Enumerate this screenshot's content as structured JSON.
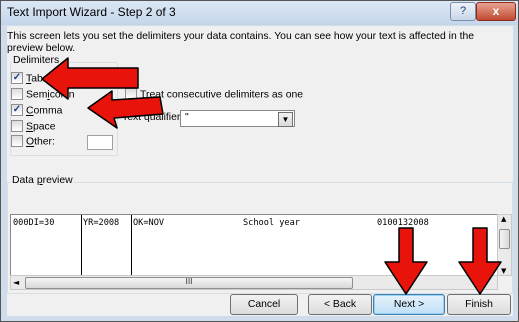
{
  "window": {
    "title": "Text Import Wizard - Step 2 of 3",
    "help_label": "?",
    "close_label": "x"
  },
  "description": "This screen lets you set the delimiters your data contains.  You can see how your text is affected in the preview below.",
  "delimiters": {
    "group_label": "Delimiters",
    "items": [
      {
        "label": "Tab",
        "checked": true
      },
      {
        "label": "Semicolon",
        "checked": false
      },
      {
        "label": "Comma",
        "checked": true
      },
      {
        "label": "Space",
        "checked": false
      },
      {
        "label": "Other:",
        "checked": false
      }
    ],
    "other_value": ""
  },
  "consecutive": {
    "label": "Treat consecutive delimiters as one",
    "checked": false
  },
  "text_qualifier": {
    "label": "Text qualifier:",
    "value": "\""
  },
  "preview": {
    "group_label": "Data preview",
    "columns": [
      "000DI=30",
      "YR=2008",
      "OK=NOV",
      "School year",
      "0100132008"
    ],
    "thumb_glyph": "III"
  },
  "buttons": {
    "cancel": "Cancel",
    "back": "< Back",
    "next": "Next >",
    "finish": "Finish"
  },
  "annotation_color": "#e8140c"
}
